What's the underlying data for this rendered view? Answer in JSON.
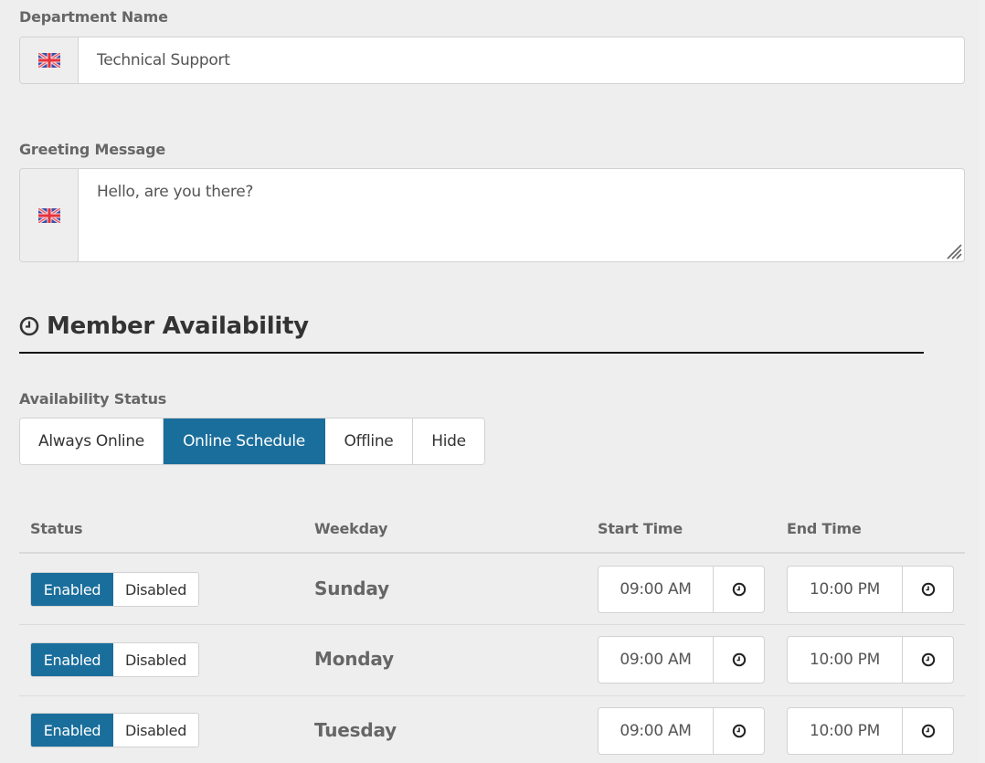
{
  "department": {
    "label": "Department Name",
    "language_icon": "uk-flag-icon",
    "value": "Technical Support"
  },
  "greeting": {
    "label": "Greeting Message",
    "language_icon": "uk-flag-icon",
    "value": "Hello, are you there?"
  },
  "availability_section": {
    "icon": "clock-icon",
    "title": "Member Availability"
  },
  "availability_status": {
    "label": "Availability Status",
    "options": [
      "Always Online",
      "Online Schedule",
      "Offline",
      "Hide"
    ],
    "selected": "Online Schedule"
  },
  "schedule": {
    "columns": [
      "Status",
      "Weekday",
      "Start Time",
      "End Time"
    ],
    "rows": [
      {
        "enabled_label": "Enabled",
        "disabled_label": "Disabled",
        "status": "Enabled",
        "weekday": "Sunday",
        "start_time": "09:00 AM",
        "end_time": "10:00 PM"
      },
      {
        "enabled_label": "Enabled",
        "disabled_label": "Disabled",
        "status": "Enabled",
        "weekday": "Monday",
        "start_time": "09:00 AM",
        "end_time": "10:00 PM"
      },
      {
        "enabled_label": "Enabled",
        "disabled_label": "Disabled",
        "status": "Enabled",
        "weekday": "Tuesday",
        "start_time": "09:00 AM",
        "end_time": "10:00 PM"
      }
    ]
  },
  "colors": {
    "accent": "#1a6e9c",
    "background": "#eeeeee",
    "border": "#d2d2d2"
  }
}
